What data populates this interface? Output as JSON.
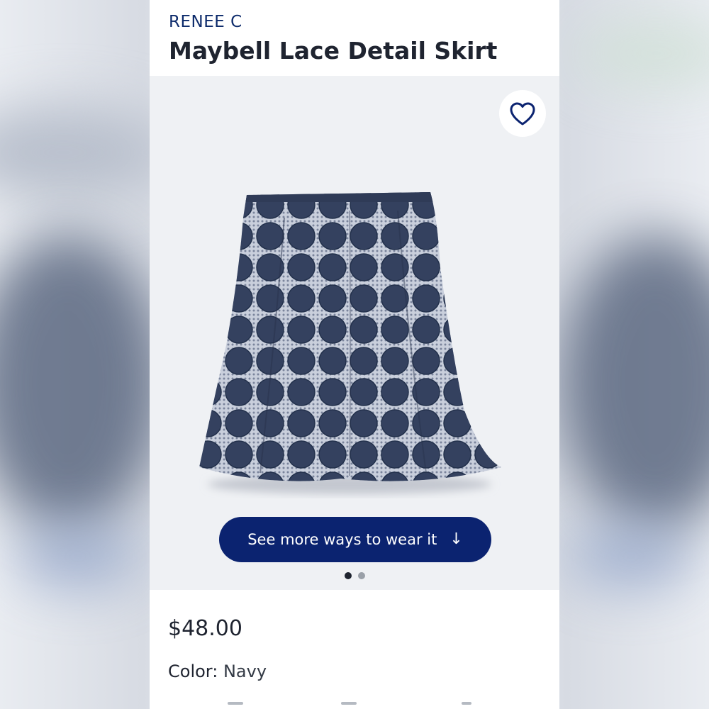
{
  "product": {
    "brand": "RENEE C",
    "title": "Maybell Lace Detail Skirt",
    "price": "$48.00",
    "color_label": "Color:",
    "color_value": "Navy"
  },
  "media": {
    "favorite_icon": "heart-outline-icon",
    "cta_label": "See more ways to wear it",
    "cta_icon": "arrow-down-icon",
    "carousel_pages": 2,
    "carousel_active": 1
  },
  "colors": {
    "brand_navy": "#0b2370",
    "skirt_navy": "#33405f",
    "text_dark": "#1f2430"
  }
}
